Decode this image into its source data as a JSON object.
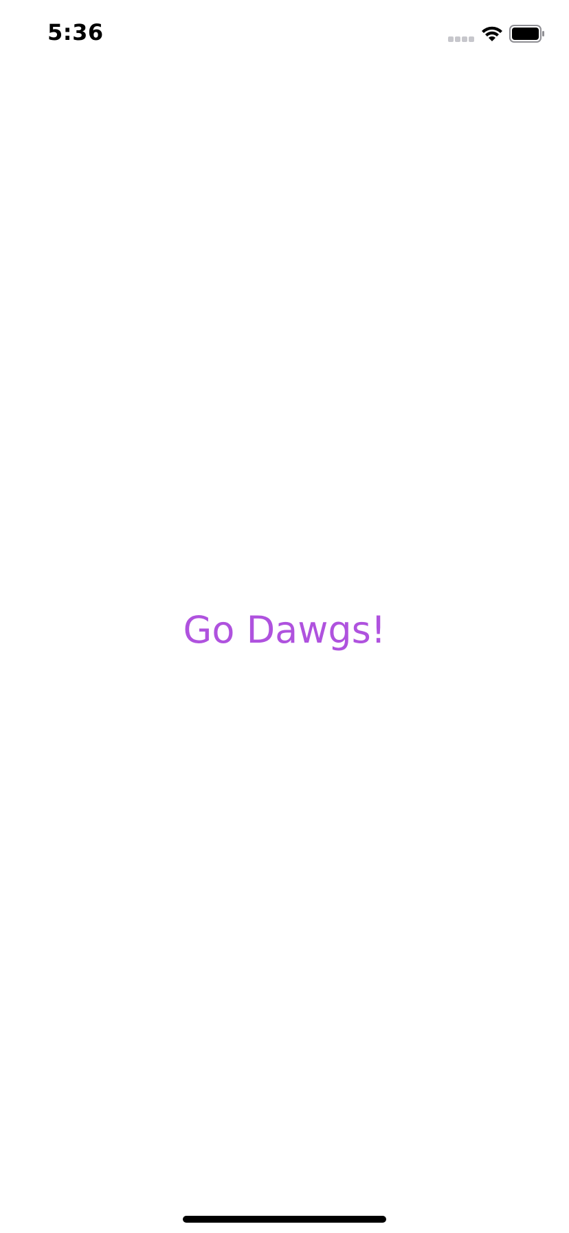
{
  "status_bar": {
    "time": "5:36",
    "icons": [
      "signal-icon",
      "wifi-icon",
      "battery-icon"
    ]
  },
  "main": {
    "message": "Go Dawgs!",
    "message_color": "#af52de"
  },
  "colors": {
    "background": "#ffffff",
    "text_primary": "#000000",
    "accent": "#af52de"
  }
}
